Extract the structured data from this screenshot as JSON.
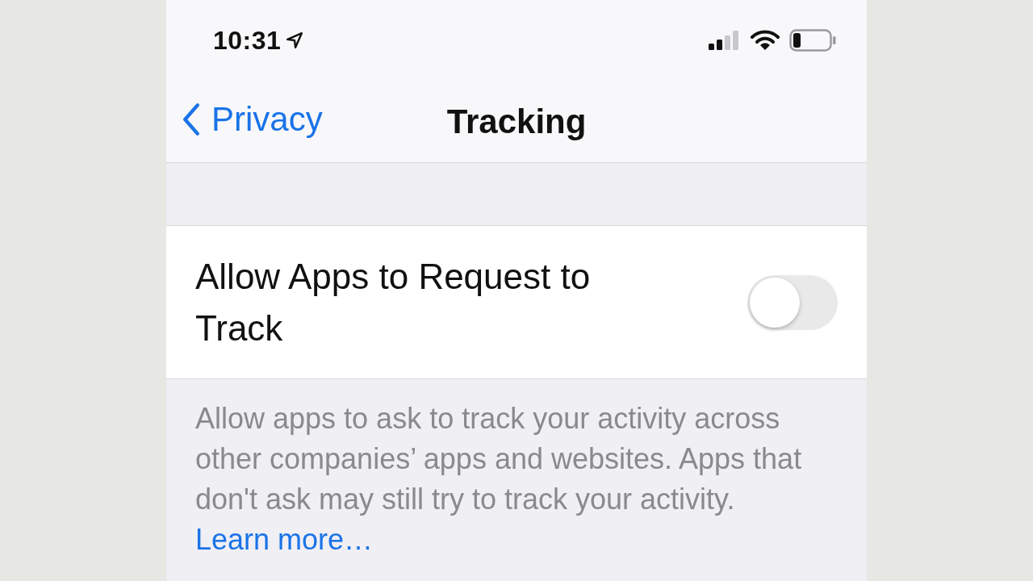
{
  "status_bar": {
    "time": "10:31"
  },
  "nav": {
    "back_label": "Privacy",
    "title": "Tracking"
  },
  "setting": {
    "label": "Allow Apps to Request to Track",
    "on": false
  },
  "footer": {
    "text": "Allow apps to ask to track your activity across other companies’ apps and websites. Apps that don't ask may still try to track your activity.",
    "link": "Learn more…"
  }
}
